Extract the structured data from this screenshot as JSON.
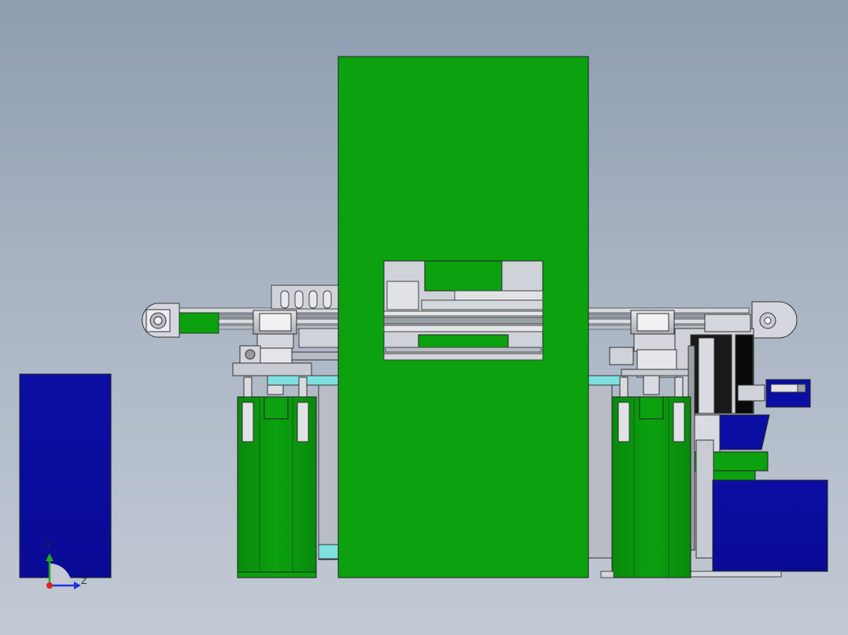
{
  "viewport": {
    "background_top": "#8e9db0",
    "background_bottom": "#c3cad5"
  },
  "colors": {
    "machine_green": "#0ba10f",
    "panel_blue": "#0b0ea2",
    "frame_cyan": "#7fe0e0",
    "metal_gray": "#c8cbd2",
    "metal_dark": "#7a7f88",
    "line": "#333333"
  },
  "triad": {
    "x_label": "Y",
    "z_label": "Z",
    "y_color": "#22aa22",
    "z_color": "#2233dd",
    "origin_color": "#dd2222"
  }
}
